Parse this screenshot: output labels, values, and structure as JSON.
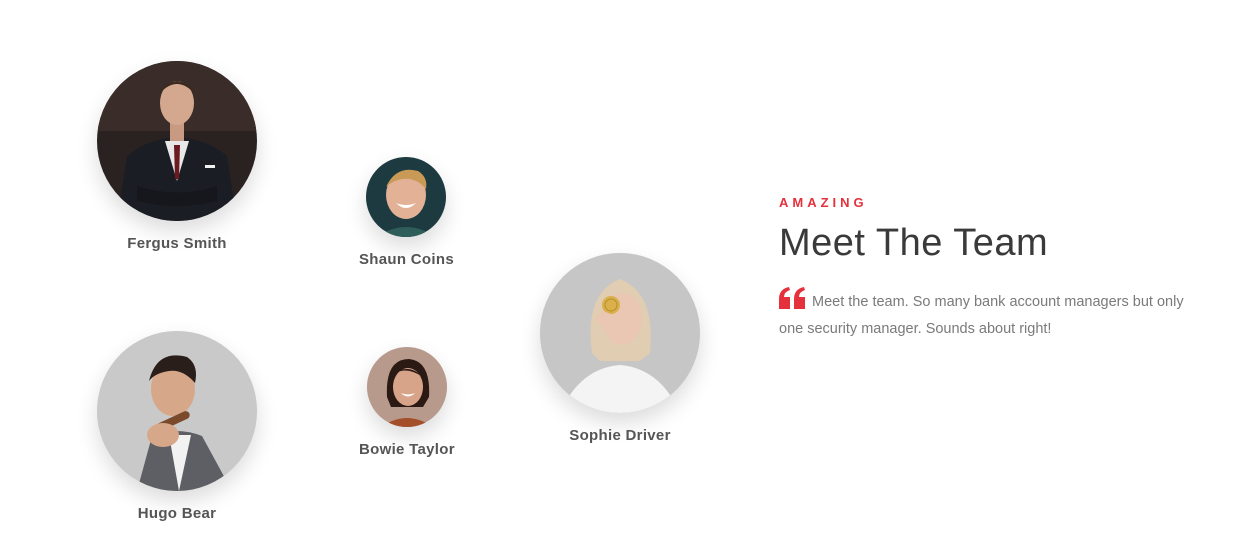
{
  "team": {
    "members": [
      {
        "name": "Fergus Smith"
      },
      {
        "name": "Shaun Coins"
      },
      {
        "name": "Hugo Bear"
      },
      {
        "name": "Bowie Taylor"
      },
      {
        "name": "Sophie Driver"
      }
    ]
  },
  "intro": {
    "eyebrow": "AMAZING",
    "heading": "Meet The Team",
    "quote": "Meet the team. So many bank account managers but only one security manager. Sounds about right!"
  },
  "icons": {
    "quote": "quote-icon",
    "avatar": "person-photo"
  },
  "colors": {
    "accent": "#e5313c",
    "heading": "#3a3a3a",
    "body": "#7a7a7a",
    "name": "#555555"
  }
}
